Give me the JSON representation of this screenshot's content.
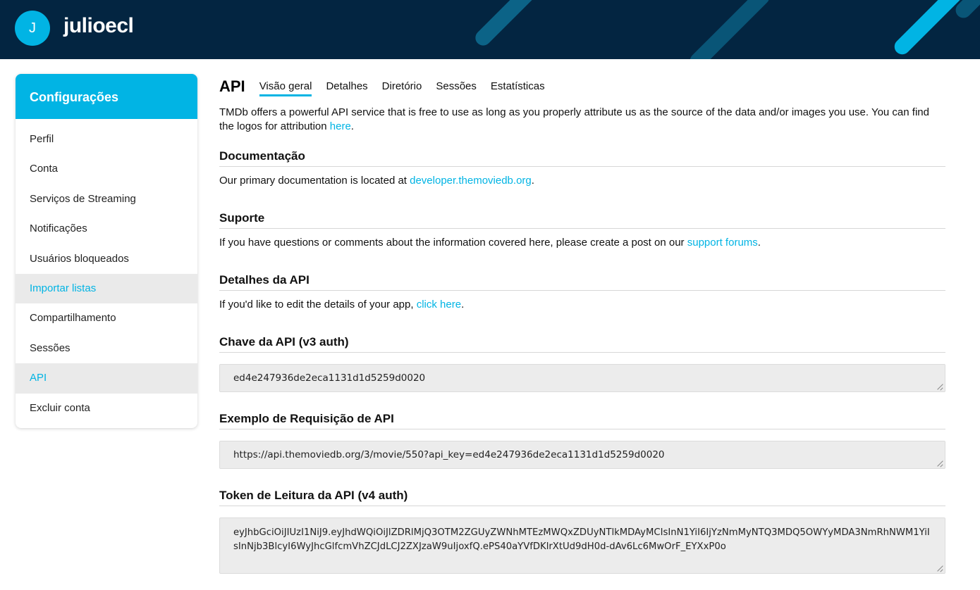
{
  "header": {
    "avatar_letter": "J",
    "username": "julioecl"
  },
  "sidebar": {
    "title": "Configurações",
    "items": [
      {
        "label": "Perfil",
        "active": false
      },
      {
        "label": "Conta",
        "active": false
      },
      {
        "label": "Serviços de Streaming",
        "active": false
      },
      {
        "label": "Notificações",
        "active": false
      },
      {
        "label": "Usuários bloqueados",
        "active": false
      },
      {
        "label": "Importar listas",
        "active": true
      },
      {
        "label": "Compartilhamento",
        "active": false
      },
      {
        "label": "Sessões",
        "active": false
      },
      {
        "label": "API",
        "active": true
      },
      {
        "label": "Excluir conta",
        "active": false
      }
    ]
  },
  "main": {
    "title": "API",
    "tabs": [
      "Visão geral",
      "Detalhes",
      "Diretório",
      "Sessões",
      "Estatísticas"
    ],
    "active_tab": "Visão geral",
    "intro": {
      "text": "TMDb offers a powerful API service that is free to use as long as you properly attribute us as the source of the data and/or images you use. You can find the logos for attribution ",
      "link": "here",
      "after": "."
    },
    "documentation": {
      "heading": "Documentação",
      "text": "Our primary documentation is located at ",
      "link": "developer.themoviedb.org",
      "after": "."
    },
    "support": {
      "heading": "Suporte",
      "text": "If you have questions or comments about the information covered here, please create a post on our ",
      "link": "support forums",
      "after": "."
    },
    "details": {
      "heading": "Detalhes da API",
      "text": "If you'd like to edit the details of your app, ",
      "link": "click here",
      "after": "."
    },
    "api_key": {
      "heading": "Chave da API (v3 auth)",
      "value": "ed4e247936de2eca1131d1d5259d0020"
    },
    "example": {
      "heading": "Exemplo de Requisição de API",
      "value": "https://api.themoviedb.org/3/movie/550?api_key=ed4e247936de2eca1131d1d5259d0020"
    },
    "token": {
      "heading": "Token de Leitura da API (v4 auth)",
      "value": "eyJhbGciOiJIUzI1NiJ9.eyJhdWQiOiJlZDRlMjQ3OTM2ZGUyZWNhMTEzMWQxZDUyNTlkMDAyMCIsInN1YiI6IjYzNmMyNTQ3MDQ5OWYyMDA3NmRhNWM1YiIsInNjb3BlcyI6WyJhcGlfcmVhZCJdLCJ2ZXJzaW9uIjoxfQ.ePS40aYVfDKlrXtUd9dH0d-dAv6Lc6MwOrF_EYXxP0o"
    }
  },
  "colors": {
    "header_bg": "#032541",
    "accent": "#01b4e4"
  }
}
